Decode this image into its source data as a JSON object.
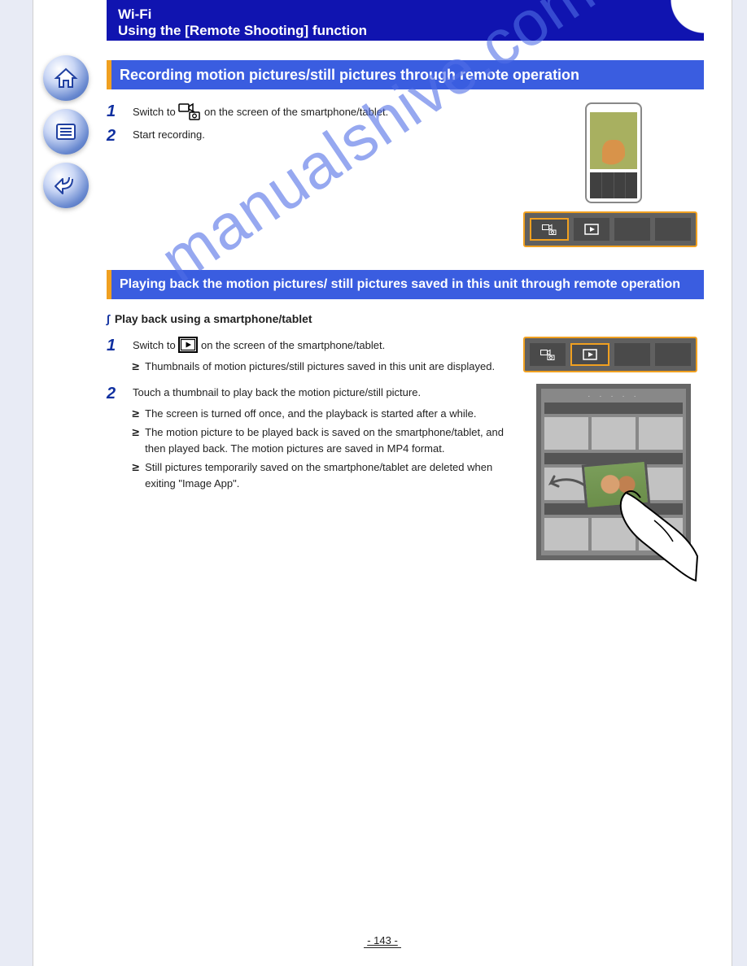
{
  "watermark": "manualshive.com",
  "nav": {
    "home": "home",
    "list": "contents",
    "back": "back"
  },
  "chapter": {
    "label": "Wi-Fi",
    "title": "Using the [Remote Shooting] function"
  },
  "sections": {
    "recording": {
      "title": "Recording motion pictures/still pictures through remote operation",
      "steps": [
        {
          "num": "1",
          "text_before": "Switch to ",
          "text_after": " on the screen of the smartphone/tablet."
        },
        {
          "num": "2",
          "text": "Start recording."
        }
      ]
    },
    "playback": {
      "title": "Playing back the motion pictures/ still pictures saved in this unit through remote operation",
      "subheading": "Play back using a smartphone/tablet",
      "steps": [
        {
          "num": "1",
          "text_before": "Switch to ",
          "text_after": " on the screen of the smartphone/tablet.",
          "bullet": "Thumbnails of motion pictures/still pictures saved in this unit are displayed."
        },
        {
          "num": "2",
          "text": "Touch a thumbnail to play back the motion picture/still picture.",
          "bullets": [
            "The screen is turned off once, and the playback is started after a while.",
            "The motion picture to be played back is saved on the smartphone/tablet, and then played back. The motion pictures are saved in MP4 format.",
            "Still pictures temporarily saved on the smartphone/tablet are deleted when exiting \"Image App\"."
          ]
        }
      ]
    }
  },
  "page_number": "- 143 -"
}
